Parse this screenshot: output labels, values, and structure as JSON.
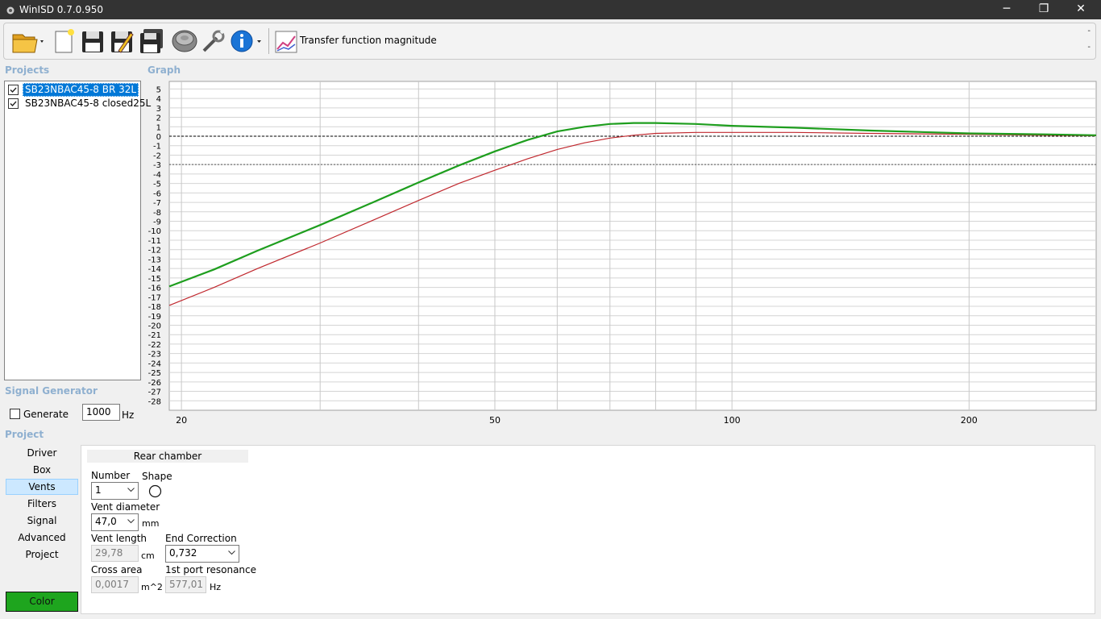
{
  "window": {
    "title": "WinISD 0.7.0.950"
  },
  "window_buttons": {
    "minimize": "─",
    "restore": "❐",
    "close": "✕"
  },
  "toolbar": {
    "view_label": "Transfer function magnitude",
    "icons": [
      "open-folder-icon",
      "new-document-icon",
      "save-icon",
      "save-as-icon",
      "save-all-icon",
      "driver-icon",
      "tools-icon",
      "info-icon",
      "graph-icon"
    ],
    "overflow_top": "-",
    "overflow_bottom": "-"
  },
  "sections": {
    "projects": "Projects",
    "graph": "Graph",
    "signal_generator": "Signal Generator",
    "project": "Project"
  },
  "projects": [
    {
      "name": "SB23NBAC45-8 BR 32L",
      "checked": true,
      "selected": true
    },
    {
      "name": "SB23NBAC45-8 closed25L",
      "checked": true,
      "selected": false
    }
  ],
  "signal_generator": {
    "generate_label": "Generate",
    "generate_checked": false,
    "frequency": "1000",
    "unit": "Hz"
  },
  "project_nav": {
    "items": [
      "Driver",
      "Box",
      "Vents",
      "Filters",
      "Signal",
      "Advanced",
      "Project"
    ],
    "active": "Vents",
    "color_button": "Color",
    "color_value": "#1ea51e"
  },
  "vents": {
    "tab": "Rear chamber",
    "number_label": "Number",
    "number_value": "1",
    "shape_label": "Shape",
    "diameter_label": "Vent diameter",
    "diameter_value": "47,0",
    "diameter_unit": "mm",
    "length_label": "Vent length",
    "length_value": "29,78",
    "length_unit": "cm",
    "end_correction_label": "End Correction",
    "end_correction_value": "0,732",
    "cross_area_label": "Cross area",
    "cross_area_value": "0,0017",
    "cross_area_unit": "m^2",
    "resonance_label": "1st port resonance",
    "resonance_value": "577,01",
    "resonance_unit": "Hz"
  },
  "chart_data": {
    "type": "line",
    "title": "",
    "xlabel": "",
    "ylabel": "",
    "x_scale": "log",
    "xlim": [
      19.3,
      290
    ],
    "ylim": [
      -29,
      5.8
    ],
    "y_ticks": [
      5,
      4,
      3,
      2,
      1,
      0,
      -1,
      -2,
      -3,
      -4,
      -5,
      -6,
      -7,
      -8,
      -9,
      -10,
      -11,
      -12,
      -13,
      -14,
      -15,
      -16,
      -17,
      -18,
      -19,
      -20,
      -21,
      -22,
      -23,
      -24,
      -25,
      -26,
      -27,
      -28
    ],
    "x_tick_labels": [
      20,
      50,
      100,
      200
    ],
    "x_gridlines": [
      20,
      30,
      40,
      50,
      60,
      70,
      80,
      90,
      100,
      200
    ],
    "reference_lines": [
      0,
      -3
    ],
    "grid": true,
    "series": [
      {
        "color": "#1e9e1e",
        "x": [
          19.3,
          22,
          25,
          30,
          35,
          40,
          45,
          50,
          55,
          60,
          65,
          70,
          75,
          80,
          90,
          100,
          120,
          150,
          200,
          250,
          290
        ],
        "y": [
          -15.9,
          -14.1,
          -12.1,
          -9.4,
          -7.0,
          -4.9,
          -3.1,
          -1.6,
          -0.4,
          0.5,
          1.0,
          1.3,
          1.4,
          1.4,
          1.3,
          1.1,
          0.9,
          0.6,
          0.3,
          0.2,
          0.1
        ]
      },
      {
        "color": "#c0282e",
        "x": [
          19.3,
          22,
          25,
          30,
          35,
          40,
          45,
          50,
          55,
          60,
          65,
          70,
          75,
          80,
          90,
          100,
          120,
          150,
          200,
          250,
          290
        ],
        "y": [
          -17.9,
          -16.0,
          -14.0,
          -11.3,
          -8.9,
          -6.8,
          -5.0,
          -3.6,
          -2.4,
          -1.4,
          -0.7,
          -0.2,
          0.1,
          0.3,
          0.4,
          0.4,
          0.4,
          0.3,
          0.2,
          0.1,
          0.05
        ]
      }
    ]
  }
}
